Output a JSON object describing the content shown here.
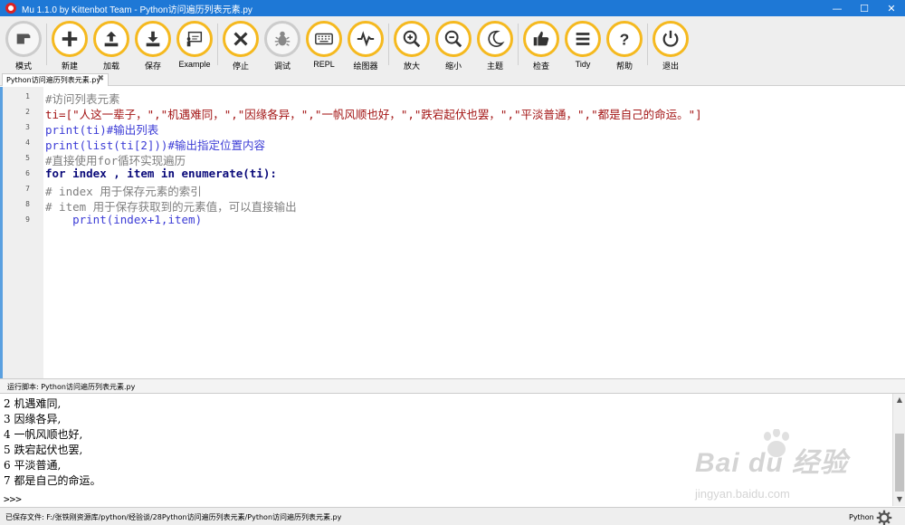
{
  "window": {
    "title": "Mu 1.1.0 by Kittenbot Team - Python访问遍历列表元素.py",
    "minimize": "—",
    "maximize": "☐",
    "close": "✕"
  },
  "toolbar": {
    "mode": "模式",
    "new": "新建",
    "load": "加载",
    "save": "保存",
    "example": "Example",
    "stop": "停止",
    "debug": "调试",
    "repl": "REPL",
    "plotter": "绘图器",
    "zoom_in": "放大",
    "zoom_out": "缩小",
    "theme": "主题",
    "check": "检查",
    "tidy": "Tidy",
    "help": "帮助",
    "quit": "退出"
  },
  "tab": {
    "label": "Python访问遍历列表元素.py",
    "close": "✖"
  },
  "editor": {
    "lines": [
      {
        "n": "1",
        "code": "#访问列表元素"
      },
      {
        "n": "2",
        "code": "ti=[\"人这一辈子，\",\"机遇难同，\",\"因缘各异，\",\"一帆风顺也好，\",\"跌宕起伏也罢，\",\"平淡普通，\",\"都是自己的命运。\"]"
      },
      {
        "n": "3",
        "code": "print(ti)#输出列表"
      },
      {
        "n": "4",
        "code": "print(list(ti[2]))#输出指定位置内容"
      },
      {
        "n": "5",
        "code": "#直接使用for循环实现遍历"
      },
      {
        "n": "6",
        "code": "for index , item in enumerate(ti):"
      },
      {
        "n": "7",
        "code": "# index 用于保存元素的索引"
      },
      {
        "n": "8",
        "code": "# item 用于保存获取到的元素值，可以直接输出"
      },
      {
        "n": "9",
        "code": "    print(index+1,item)"
      }
    ]
  },
  "run": {
    "label": "运行脚本: Python访问遍历列表元素.py"
  },
  "output": {
    "lines": [
      "2 机遇难同,",
      "3 因缘各异,",
      "4 一帆风顺也好,",
      "5 跌宕起伏也罢,",
      "6 平淡普通,",
      "7 都是自己的命运。"
    ],
    "prompt": ">>>"
  },
  "watermark": {
    "brand": "Bai du 经验",
    "url": "jingyan.baidu.com"
  },
  "status": {
    "saved": "已保存文件: F:/张铁刚资源库/python/经验谈/28Python访问遍历列表元素/Python访问遍历列表元素.py",
    "mode": "Python"
  },
  "colors": {
    "accent": "#f5b91f",
    "titlebar": "#1e78d6"
  }
}
